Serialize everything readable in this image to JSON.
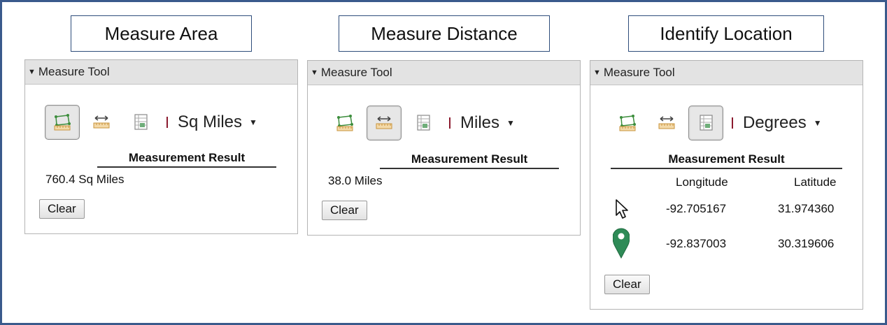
{
  "captions": {
    "area": "Measure Area",
    "distance": "Measure Distance",
    "location": "Identify Location"
  },
  "panels": [
    {
      "header": "Measure Tool",
      "units": "Sq Miles",
      "result_title": "Measurement Result",
      "result_value": "760.4 Sq Miles",
      "clear_label": "Clear",
      "active_tool": "area"
    },
    {
      "header": "Measure Tool",
      "units": "Miles",
      "result_title": "Measurement Result",
      "result_value": "38.0 Miles",
      "clear_label": "Clear",
      "active_tool": "distance"
    },
    {
      "header": "Measure Tool",
      "units": "Degrees",
      "result_title": "Measurement Result",
      "clear_label": "Clear",
      "active_tool": "location",
      "columns": [
        "Longitude",
        "Latitude"
      ],
      "rows": [
        {
          "icon": "cursor-arrow-icon",
          "longitude": "-92.705167",
          "latitude": "31.974360"
        },
        {
          "icon": "map-pin-icon",
          "longitude": "-92.837003",
          "latitude": "30.319606"
        }
      ]
    }
  ],
  "colors": {
    "frame_border": "#3a5a8c",
    "caption_border": "#2e4d7b",
    "header_bg": "#e3e3e3",
    "pin_green": "#2e8b57",
    "separator": "#8b1a2e"
  }
}
